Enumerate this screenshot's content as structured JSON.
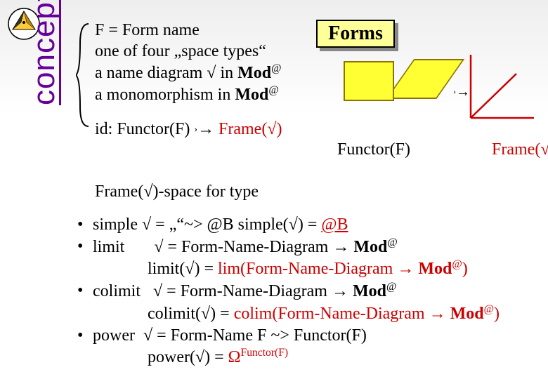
{
  "sidebar": {
    "label": "concepts"
  },
  "title": {
    "forms": "Forms"
  },
  "definition": {
    "l1a": "F = Form name",
    "l2a": "one of four „space types“",
    "l3a": "a name diagram ",
    "l3b": " in ",
    "l3c": "Mod",
    "l3d": "@",
    "l4a": "a monomorphism in ",
    "l4b": "Mod",
    "l4c": "@"
  },
  "idline": {
    "a": "id: Functor(F) ",
    "mono": "›",
    "arr": "→",
    "frame": " Frame(",
    "close": ")"
  },
  "diag": {
    "mono": "›",
    "arr": "→",
    "functor": "Functor(F)",
    "frame": "Frame(",
    "close": ")"
  },
  "space": {
    "a": "Frame(",
    "b": ")-space for type"
  },
  "bullets": {
    "b1": {
      "lbl": "simple",
      "eq": " = „“",
      "map": "~>",
      "rhs": " @B     simple(",
      "rhs2": ") = ",
      "val": "@B"
    },
    "b2": {
      "lbl": "limit",
      "eq": " = Form-Name-Diagram ",
      "arr": "→",
      "rhs": " Mod",
      "at": "@",
      "sub_a": "limit(",
      "sub_b": ") = ",
      "val_a": "lim(Form-Name-Diagram ",
      "val_arr": "→",
      "val_b": " Mod",
      "val_at": "@",
      "val_c": ")"
    },
    "b3": {
      "lbl": "colimit",
      "eq": " = Form-Name-Diagram ",
      "arr": "→",
      "rhs": " Mod",
      "at": "@",
      "sub_a": "colimit(",
      "sub_b": ") = ",
      "val_a": "colim(Form-Name-Diagram ",
      "val_arr": "→",
      "val_b": " Mod",
      "val_at": "@",
      "val_c": ")"
    },
    "b4": {
      "lbl": "power",
      "eq": " = Form-Name F ",
      "map": "~>",
      "rhs": " Functor(F)",
      "sub_a": "power(",
      "sub_b": ") = ",
      "omega": "Ω",
      "exp": "Functor(F)"
    }
  },
  "glyph": {
    "sqrt": "√",
    "bullet": "•"
  }
}
